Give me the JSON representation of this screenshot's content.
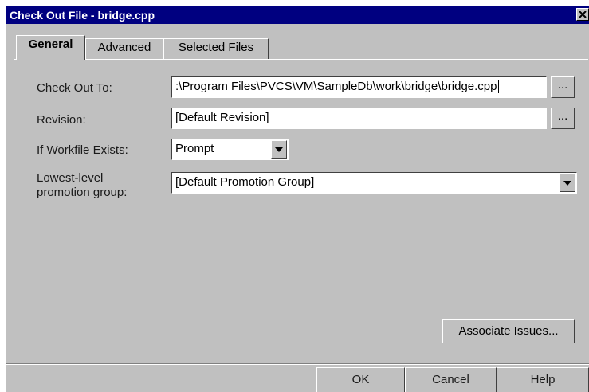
{
  "window": {
    "title": "Check Out File - bridge.cpp"
  },
  "tabs": [
    {
      "label": "General",
      "active": true
    },
    {
      "label": "Advanced",
      "active": false
    },
    {
      "label": "Selected Files",
      "active": false
    }
  ],
  "form": {
    "check_out_to": {
      "label": "Check Out To:",
      "value": ":\\Program Files\\PVCS\\VM\\SampleDb\\work\\bridge\\bridge.cpp",
      "browse_label": "..."
    },
    "revision": {
      "label": "Revision:",
      "value": "[Default Revision]",
      "browse_label": "..."
    },
    "if_workfile_exists": {
      "label": "If Workfile Exists:",
      "value": "Prompt"
    },
    "promotion_group": {
      "label_line1": "Lowest-level",
      "label_line2": "promotion group:",
      "value": "[Default Promotion Group]"
    }
  },
  "associate_issues_label": "Associate Issues...",
  "buttons": {
    "ok": "OK",
    "cancel": "Cancel",
    "help": "Help"
  },
  "icons": {
    "close": "close-icon",
    "dropdown": "chevron-down-icon"
  }
}
